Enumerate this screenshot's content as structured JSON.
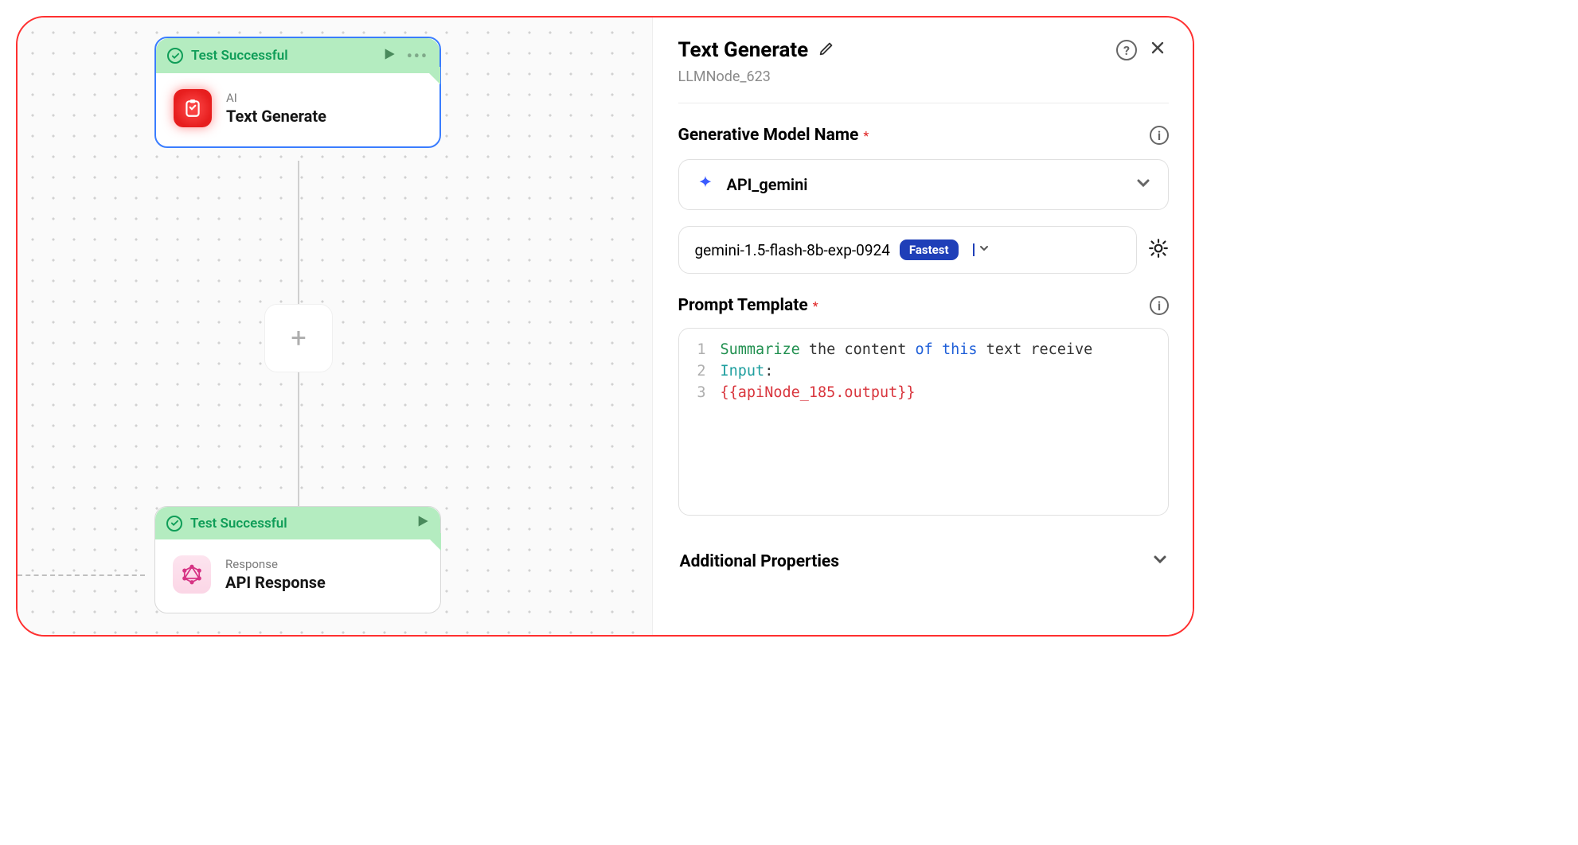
{
  "canvas": {
    "node1": {
      "status": "Test Successful",
      "category": "AI",
      "title": "Text Generate"
    },
    "node2": {
      "status": "Test Successful",
      "category": "Response",
      "title": "API Response"
    },
    "plus": "+"
  },
  "panel": {
    "title": "Text Generate",
    "subtitle": "LLMNode_623",
    "model_label": "Generative Model Name",
    "model_select": "API_gemini",
    "model_version": "gemini-1.5-flash-8b-exp-0924",
    "model_badge": "Fastest",
    "prompt_label": "Prompt Template",
    "code": {
      "l1": {
        "n": "1",
        "a": "Summarize",
        "b": " the content ",
        "c": "of",
        "d": " ",
        "e": "this",
        "f": " text receive"
      },
      "l2": {
        "n": "2",
        "a": "Input",
        "colon": ":"
      },
      "l3": {
        "n": "3",
        "a": "{{apiNode_185.output}}"
      }
    },
    "additional": "Additional Properties"
  }
}
